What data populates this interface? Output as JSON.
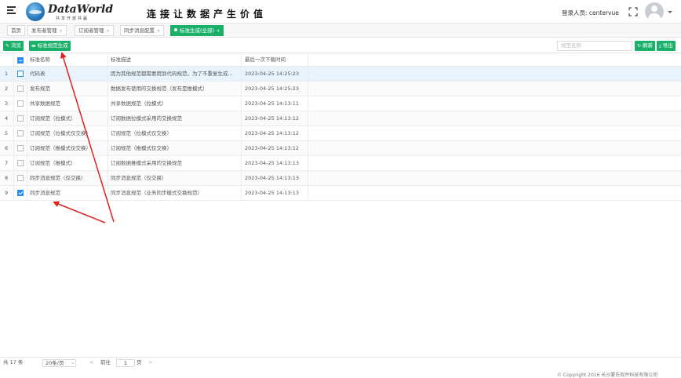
{
  "header": {
    "logo_name": "DataWorld",
    "logo_slogan": "共享开放共赢",
    "slogan": "连接让数据产生价值",
    "user_label": "登录人员: centervue"
  },
  "tabs": [
    {
      "label": "首页",
      "closable": false
    },
    {
      "label": "发布者管理",
      "closable": true
    },
    {
      "label": "订阅者管理",
      "closable": true
    },
    {
      "label": "同步消息配置",
      "closable": true
    },
    {
      "label": "标准生成(全部)",
      "closable": true,
      "active": true
    }
  ],
  "toolbar": {
    "browse_label": "浏览",
    "generate_label": "标准规范生成",
    "search_placeholder": "规范名称",
    "refresh_label": "刷新",
    "export_label": "导出"
  },
  "grid": {
    "columns": [
      "标准名称",
      "标准描述",
      "最后一次下载时间"
    ],
    "rows": [
      {
        "num": "1",
        "name": "代码表",
        "desc": "因为其他规范都需要用到代码规范，为了不重复生成...",
        "time": "2023-04-25 14:25:23",
        "checked": false,
        "highlight": true
      },
      {
        "num": "2",
        "name": "发布规范",
        "desc": "数据发布使用的交换规范（发布是推模式）",
        "time": "2023-04-25 14:25:23",
        "checked": false
      },
      {
        "num": "3",
        "name": "共享数据规范",
        "desc": "共享数据规范（拉模式）",
        "time": "2023-04-25 14:13:11",
        "checked": false
      },
      {
        "num": "4",
        "name": "订阅规范（拉模式）",
        "desc": "订阅数据拉模式采用的交换规范",
        "time": "2023-04-25 14:13:12",
        "checked": false
      },
      {
        "num": "5",
        "name": "订阅规范（拉模式仅交换）",
        "desc": "订阅规范（拉模式仅交换）",
        "time": "2023-04-25 14:13:12",
        "checked": false
      },
      {
        "num": "6",
        "name": "订阅规范（推模式仅交换）",
        "desc": "订阅规范（推模式仅交换）",
        "time": "2023-04-25 14:13:12",
        "checked": false
      },
      {
        "num": "7",
        "name": "订阅规范（推模式）",
        "desc": "订阅数据推模式采用的交换规范",
        "time": "2023-04-25 14:13:13",
        "checked": false
      },
      {
        "num": "8",
        "name": "同步消息规范（仅交换）",
        "desc": "同步消息规范（仅交换）",
        "time": "2023-04-25 14:13:13",
        "checked": false
      },
      {
        "num": "9",
        "name": "同步消息规范",
        "desc": "同步消息规范（业务同步模式交换规范）",
        "time": "2023-04-25 14:13:13",
        "checked": true
      }
    ]
  },
  "pager": {
    "total": "共 17 条",
    "page_size": "20条/页",
    "goto_label": "前往",
    "current_page": "1",
    "page_unit": "页",
    "prev": "<",
    "next": ">"
  },
  "footer": {
    "copyright": "© Copyright 2016 长沙蒙氏软件科技有限公司"
  },
  "colors": {
    "accent": "#1ab06a",
    "checkbox": "#2d8cf0",
    "arrow": "#e02020"
  }
}
